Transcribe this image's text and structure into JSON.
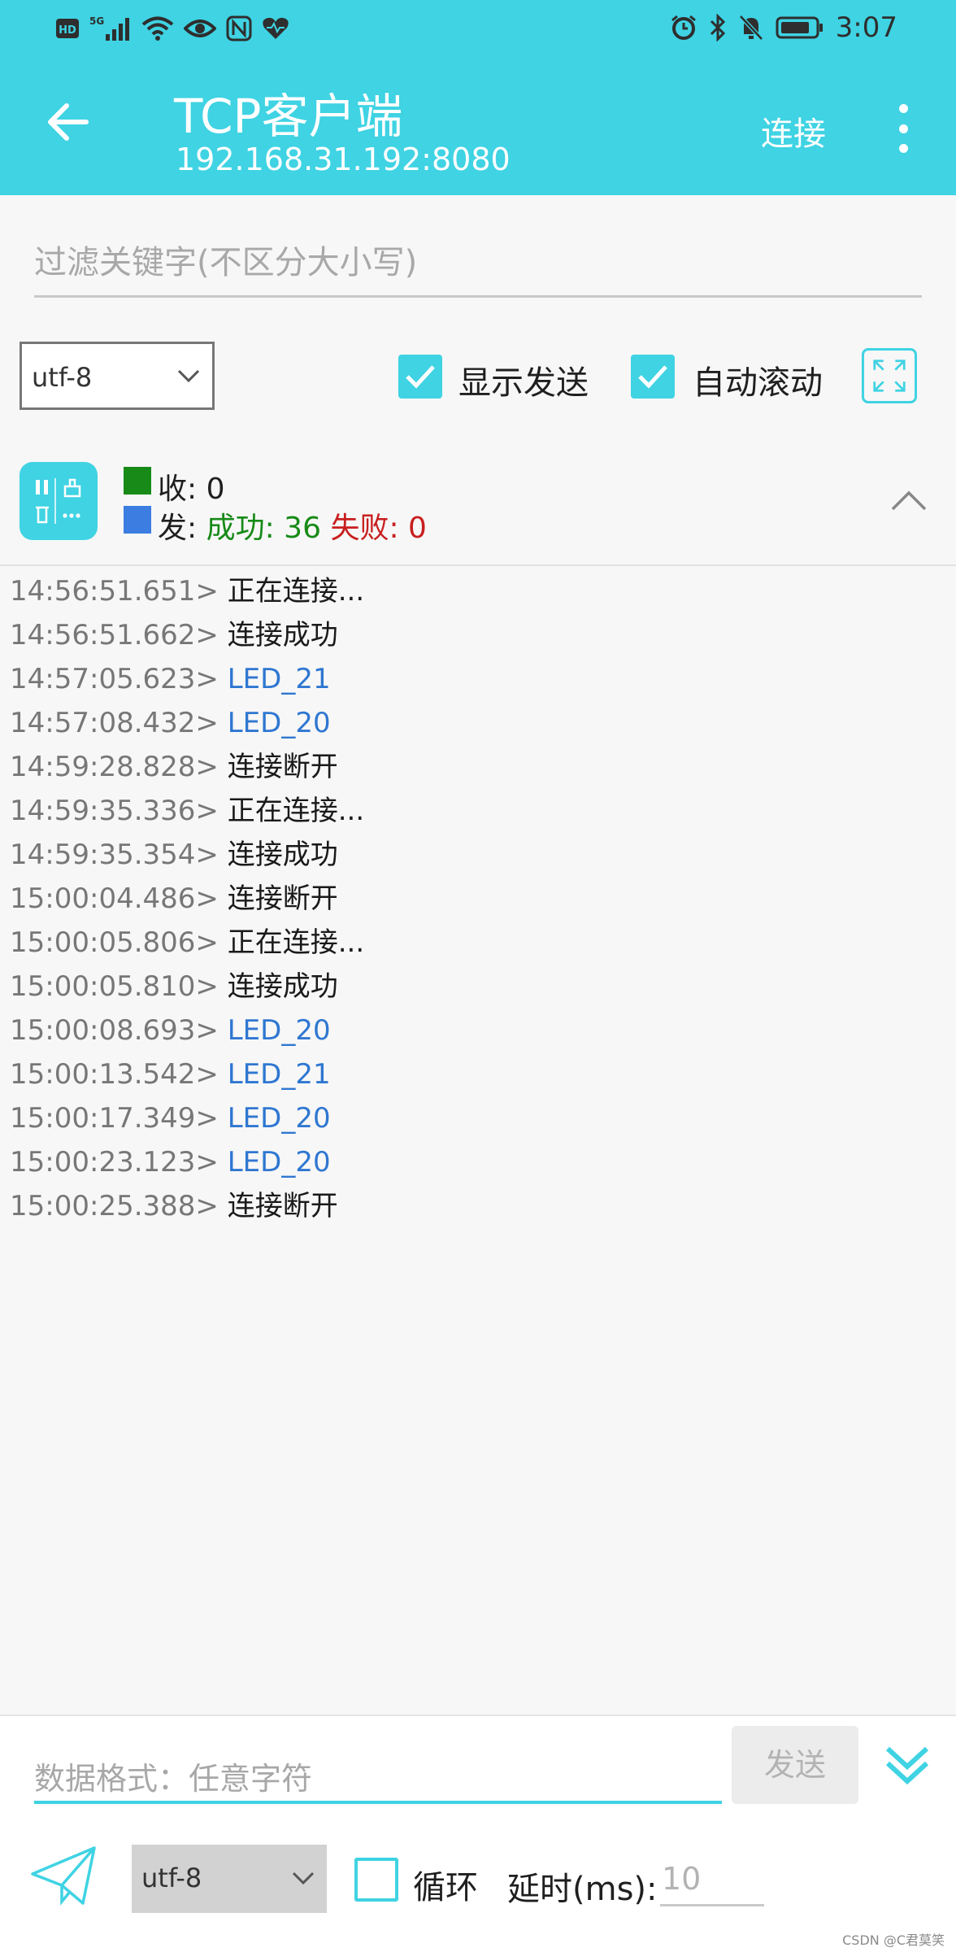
{
  "statusbar": {
    "left_icons": [
      "hd-icon",
      "5g-signal-icon",
      "wifi-icon",
      "eye-icon",
      "nfc-icon",
      "heart-icon"
    ],
    "time": "3:07",
    "hd": "HD",
    "five_g": "5G"
  },
  "appbar": {
    "title": "TCP客户端",
    "subtitle": "192.168.31.192:8080",
    "connect_label": "连接"
  },
  "filter": {
    "placeholder": "过滤关键字(不区分大小写)"
  },
  "options": {
    "encoding": "utf-8",
    "show_send_label": "显示发送",
    "show_send_checked": true,
    "auto_scroll_label": "自动滚动",
    "auto_scroll_checked": true
  },
  "stats": {
    "recv_label": "收:",
    "recv_value": "0",
    "send_label": "发:",
    "success_text": "成功: 36",
    "fail_text": "失败: 0"
  },
  "log": [
    {
      "ts": "14:56:51.651>",
      "msg": "正在连接...",
      "kind": "sys"
    },
    {
      "ts": "14:56:51.662>",
      "msg": "连接成功",
      "kind": "sys"
    },
    {
      "ts": "14:57:05.623>",
      "msg": "LED_21",
      "kind": "sent"
    },
    {
      "ts": "14:57:08.432>",
      "msg": "LED_20",
      "kind": "sent"
    },
    {
      "ts": "14:59:28.828>",
      "msg": "连接断开",
      "kind": "sys"
    },
    {
      "ts": "14:59:35.336>",
      "msg": "正在连接...",
      "kind": "sys"
    },
    {
      "ts": "14:59:35.354>",
      "msg": "连接成功",
      "kind": "sys"
    },
    {
      "ts": "15:00:04.486>",
      "msg": "连接断开",
      "kind": "sys"
    },
    {
      "ts": "15:00:05.806>",
      "msg": "正在连接...",
      "kind": "sys"
    },
    {
      "ts": "15:00:05.810>",
      "msg": "连接成功",
      "kind": "sys"
    },
    {
      "ts": "15:00:08.693>",
      "msg": "LED_20",
      "kind": "sent"
    },
    {
      "ts": "15:00:13.542>",
      "msg": "LED_21",
      "kind": "sent"
    },
    {
      "ts": "15:00:17.349>",
      "msg": "LED_20",
      "kind": "sent"
    },
    {
      "ts": "15:00:23.123>",
      "msg": "LED_20",
      "kind": "sent"
    },
    {
      "ts": "15:00:25.388>",
      "msg": "连接断开",
      "kind": "sys"
    }
  ],
  "bottom": {
    "data_placeholder": "数据格式：任意字符",
    "send_label": "发送",
    "encoding": "utf-8",
    "loop_label": "循环",
    "loop_checked": false,
    "delay_label": "延时(ms):",
    "delay_placeholder": "10"
  },
  "watermark": "CSDN @C君莫笑",
  "colors": {
    "accent": "#3fd3e3",
    "recv": "#178a17",
    "send": "#3b7de0",
    "sent_text": "#2f77d1",
    "fail": "#c81e1e"
  }
}
